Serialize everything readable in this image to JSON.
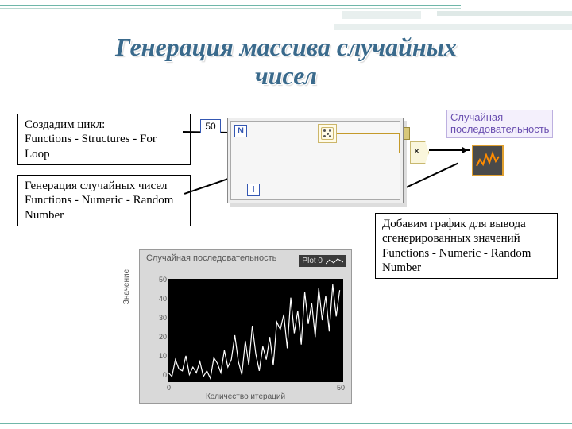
{
  "title_l1": "Генерация массива случайных",
  "title_l2": "чисел",
  "tb1_l1": "Создадим цикл:",
  "tb1_l2": "Functions - Structures - For Loop",
  "tb2_l1": "Генерация случайных чисел",
  "tb2_l2": "Functions - Numeric - Random Number",
  "tb3_l1": "Добавим график для вывода сгенерированных значений",
  "tb3_l2": "Functions - Numeric - Random Number",
  "loop": {
    "N": "N",
    "i": "i",
    "count": "50"
  },
  "mul_sym": "×",
  "graph_terminal_label": "Случайная\nпоследовательность",
  "graph_terminal_label_l1": "Случайная",
  "graph_terminal_label_l2": "последовательность",
  "panel": {
    "title": "Случайная последовательность",
    "legend": "Plot 0",
    "ylabel": "Значение",
    "xlabel": "Количество итераций",
    "yticks": [
      "50",
      "40",
      "30",
      "20",
      "10",
      "0"
    ],
    "xticks": [
      "0",
      "50"
    ]
  },
  "chart_data": {
    "type": "line",
    "title": "Случайная последовательность",
    "xlabel": "Количество итераций",
    "ylabel": "Значение",
    "ylim": [
      0,
      55
    ],
    "xlim": [
      0,
      50
    ],
    "legend": [
      "Plot 0"
    ],
    "x": [
      0,
      1,
      2,
      3,
      4,
      5,
      6,
      7,
      8,
      9,
      10,
      11,
      12,
      13,
      14,
      15,
      16,
      17,
      18,
      19,
      20,
      21,
      22,
      23,
      24,
      25,
      26,
      27,
      28,
      29,
      30,
      31,
      32,
      33,
      34,
      35,
      36,
      37,
      38,
      39,
      40,
      41,
      42,
      43,
      44,
      45,
      46,
      47,
      48,
      49
    ],
    "values": [
      5,
      3,
      12,
      7,
      6,
      14,
      4,
      8,
      5,
      11,
      3,
      6,
      2,
      13,
      10,
      5,
      17,
      8,
      12,
      25,
      11,
      4,
      22,
      9,
      30,
      15,
      6,
      19,
      12,
      24,
      9,
      32,
      28,
      36,
      18,
      45,
      26,
      38,
      20,
      48,
      31,
      42,
      24,
      50,
      33,
      46,
      27,
      52,
      35,
      49
    ]
  }
}
